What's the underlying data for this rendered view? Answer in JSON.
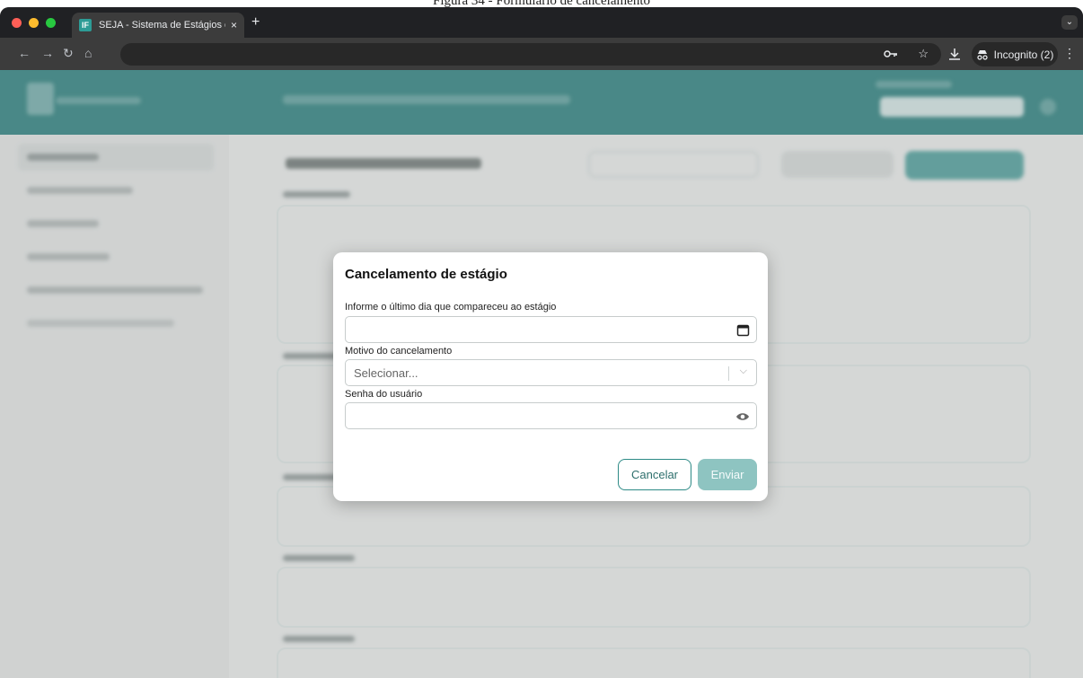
{
  "caption": "Figura 34 - Formulário de cancelamento",
  "browser": {
    "tab_title": "SEJA - Sistema de Estágios e",
    "tab_close": "×",
    "new_tab": "+",
    "incognito_label": "Incognito (2)"
  },
  "modal": {
    "title": "Cancelamento de estágio",
    "last_day_label": "Informe o último dia que compareceu ao estágio",
    "last_day_value": "",
    "reason_label": "Motivo do cancelamento",
    "reason_placeholder": "Selecionar...",
    "password_label": "Senha do usuário",
    "password_value": "",
    "cancel_label": "Cancelar",
    "send_label": "Enviar"
  },
  "colors": {
    "header_teal": "#3f8c8a",
    "primary_teal": "#2d8a86",
    "disabled_teal": "#8ec4c1"
  }
}
